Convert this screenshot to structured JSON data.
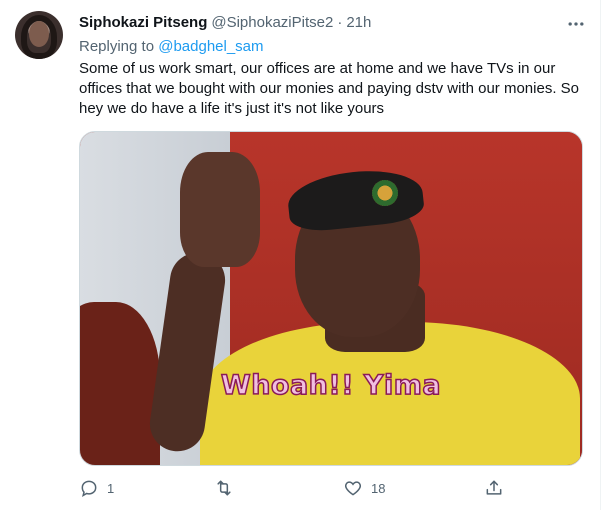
{
  "tweet": {
    "author_name": "Siphokazi Pitseng",
    "author_handle": "@SiphokaziPitse2",
    "separator": "·",
    "time": "21h",
    "replying_to_label": "Replying to",
    "replying_to_handle": "@badghel_sam",
    "text": "Some of us work smart, our offices are at home and we have TVs in our offices that we bought with our monies and paying dstv with our monies. So hey we do have a life it's just it's not like yours",
    "image_caption": "Whoah!! Yima",
    "actions": {
      "reply_count": "1",
      "retweet_count": "",
      "like_count": "18"
    }
  },
  "icons": {
    "more": "more-icon",
    "reply": "reply-icon",
    "retweet": "retweet-icon",
    "like": "like-icon",
    "share": "share-icon"
  },
  "colors": {
    "accent": "#1d9bf0",
    "secondary_text": "#536471",
    "primary_text": "#0f1419"
  }
}
